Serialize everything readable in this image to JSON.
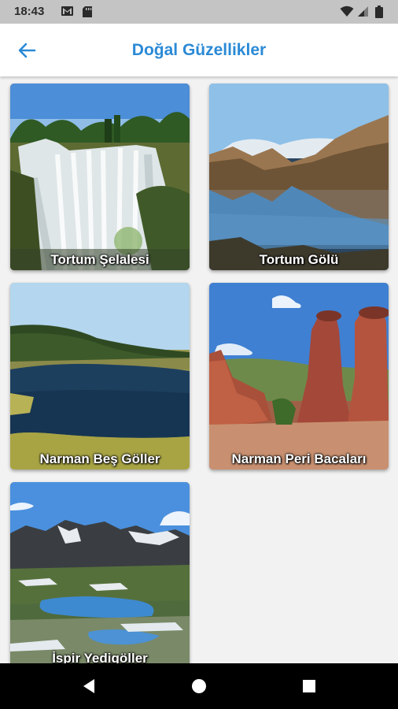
{
  "status_bar": {
    "time": "18:43"
  },
  "app_bar": {
    "title": "Doğal Güzellikler"
  },
  "places": [
    {
      "name": "Tortum Şelalesi"
    },
    {
      "name": "Tortum Gölü"
    },
    {
      "name": "Narman Beş Göller"
    },
    {
      "name": "Narman Peri Bacaları"
    },
    {
      "name": "İspir Yedigöller"
    }
  ],
  "colors": {
    "accent": "#2a8ad6",
    "status_bar": "#c4c4c4",
    "nav_bar": "#000000"
  },
  "icons": {
    "back": "arrow-left-icon",
    "status": [
      "gmail-icon",
      "sd-card-icon",
      "wifi-icon",
      "signal-icon",
      "battery-icon"
    ],
    "nav": [
      "back-triangle-icon",
      "home-circle-icon",
      "recents-square-icon"
    ]
  }
}
